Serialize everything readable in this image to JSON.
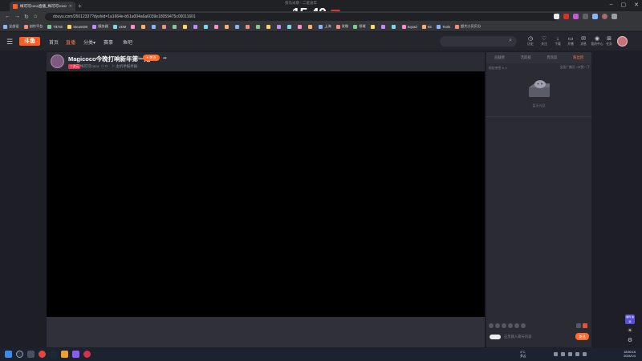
{
  "browser": {
    "tab_title": "梅可可coco直播_梅可可coco视频",
    "url": "douyu.com/25012337?dyshid=1a1664e-b51a004a6a6039e18059475c00011601",
    "bookmarks": [
      "全部设",
      "创作平台",
      "TikTok",
      "SteamDB",
      "服务器",
      "UDM",
      "",
      "",
      "",
      "",
      "",
      "",
      "",
      "",
      "",
      "",
      "",
      "",
      "",
      "",
      "",
      "",
      "",
      "",
      "上海",
      "发微",
      "领域",
      "",
      "",
      "",
      "Squad",
      "KE",
      "Tools",
      "超大小贝贝分"
    ]
  },
  "overlay": {
    "subtitle": "旁马米斯 · 二星总年",
    "price": "15.40"
  },
  "site": {
    "logo": "斗鱼",
    "nav": [
      "首页",
      "直播",
      "分类",
      "赛事",
      "鱼吧"
    ],
    "nav_active": "直播",
    "category_caret": "▾",
    "header_icons": [
      {
        "name": "history",
        "label": "历史",
        "glyph": "◷"
      },
      {
        "name": "follow",
        "label": "关注",
        "glyph": "♡"
      },
      {
        "name": "download",
        "label": "下载",
        "glyph": "↓"
      },
      {
        "name": "live",
        "label": "开播",
        "glyph": "▭"
      },
      {
        "name": "message",
        "label": "消息",
        "glyph": "✉"
      },
      {
        "name": "tasks",
        "label": "我的中心",
        "glyph": "◉"
      },
      {
        "name": "recharge",
        "label": "任务",
        "glyph": "⊞"
      }
    ]
  },
  "room": {
    "title": "Magicoco今晚打响新年第一炮",
    "follow_label": "♥ 关注",
    "tag": "二次元",
    "host_name": "梅可可coco",
    "viewers": "0",
    "report": "主机举报举报"
  },
  "chat": {
    "tabs": [
      "贡献榜",
      "活跃榜",
      "贵宾席",
      "粉丝团"
    ],
    "active_tab": "粉丝团",
    "sub_left": "粉丝亲密 ∗ ∞",
    "sub_right": "全面广播员 >点赞一下",
    "empty_text": "暂无内容",
    "input_placeholder": "这里输入聊天内容",
    "send_label": "发送"
  },
  "float": {
    "badge": "福利 抽奖"
  },
  "taskbar": {
    "weather": "4°C\n多云",
    "clock_time": "18:50:16",
    "clock_date": "2024/1/4"
  },
  "colors": {
    "accent": "#ff6a31",
    "page_bg": "#1e1f26",
    "panel_bg": "#2a2b33"
  }
}
